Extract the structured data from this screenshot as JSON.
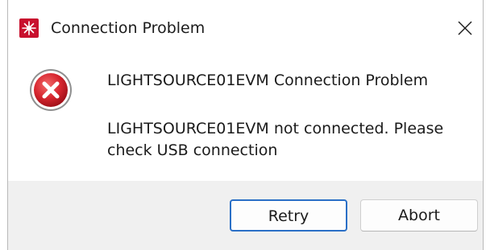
{
  "window": {
    "title": "Connection Problem",
    "icon": "app-logo-icon",
    "close_icon": "close-icon"
  },
  "content": {
    "icon": "error-icon",
    "heading": "LIGHTSOURCE01EVM Connection Problem",
    "message": "LIGHTSOURCE01EVM not connected. Please check USB connection"
  },
  "buttons": {
    "retry_label": "Retry",
    "abort_label": "Abort"
  },
  "colors": {
    "error_red": "#d7262f",
    "focus_blue": "#2a6fc6",
    "footer_bg": "#f0f0f0"
  }
}
